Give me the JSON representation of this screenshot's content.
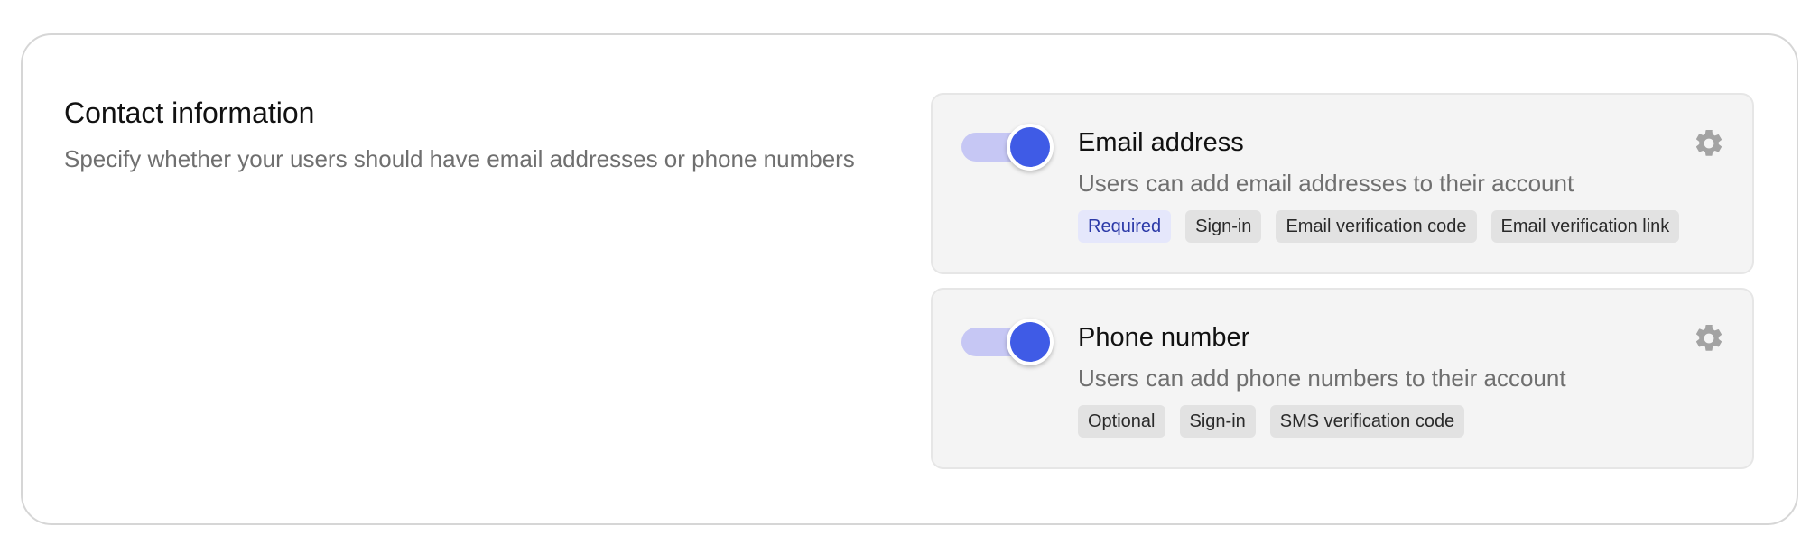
{
  "section": {
    "title": "Contact information",
    "description": "Specify whether your users should have email addresses or phone numbers"
  },
  "cards": [
    {
      "title": "Email address",
      "description": "Users can add email addresses to their account",
      "enabled": true,
      "settings_icon": "gear-icon",
      "tags": [
        "Required",
        "Sign-in",
        "Email verification code",
        "Email verification link"
      ]
    },
    {
      "title": "Phone number",
      "description": "Users can add phone numbers to their account",
      "enabled": true,
      "settings_icon": "gear-icon",
      "tags": [
        "Optional",
        "Sign-in",
        "SMS verification code"
      ]
    }
  ],
  "colors": {
    "accent": "#3f5be6",
    "toggle_track": "#c6c7f4",
    "required_tag_bg": "#e5e7fb",
    "required_tag_text": "#2c3aa8"
  }
}
